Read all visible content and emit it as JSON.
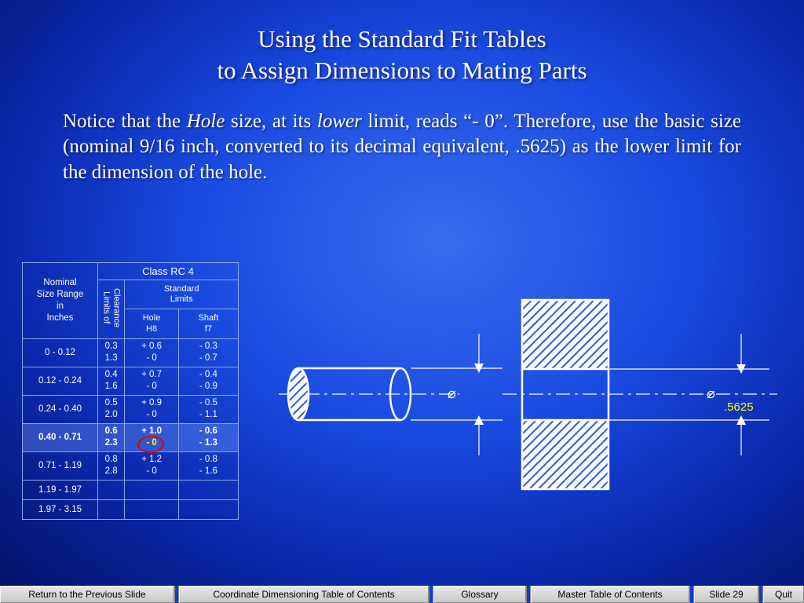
{
  "title": {
    "line1": "Using the Standard Fit Tables",
    "line2": "to Assign Dimensions to Mating Parts"
  },
  "body": {
    "prefix": "Notice that the ",
    "hole_word": "Hole",
    "mid1": " size, at its ",
    "lower_word": "lower",
    "suffix": " limit, reads “- 0”. Therefore, use the basic size (nominal 9/16 inch, converted to its decimal equivalent, .5625) as the lower limit for the dimension of the hole."
  },
  "table": {
    "nominal_label_l1": "Nominal",
    "nominal_label_l2": "Size Range",
    "nominal_label_l3": "in",
    "nominal_label_l4": "Inches",
    "class_label": "Class RC 4",
    "limits_label_l1": "Limits of",
    "limits_label_l2": "Clearance",
    "std_limits_l1": "Standard",
    "std_limits_l2": "Limits",
    "hole_col_l1": "Hole",
    "hole_col_l2": "H8",
    "shaft_col_l1": "Shaft",
    "shaft_col_l2": "f7",
    "rows": [
      {
        "range": "0      - 0.12",
        "clr1": "0.3",
        "clr2": "1.3",
        "hole1": "+ 0.6",
        "hole2": "- 0",
        "shaft1": "- 0.3",
        "shaft2": "- 0.7",
        "hl": false
      },
      {
        "range": "0.12 - 0.24",
        "clr1": "0.4",
        "clr2": "1.6",
        "hole1": "+ 0.7",
        "hole2": "- 0",
        "shaft1": "- 0.4",
        "shaft2": "- 0.9",
        "hl": false
      },
      {
        "range": "0.24 - 0.40",
        "clr1": "0.5",
        "clr2": "2.0",
        "hole1": "+ 0.9",
        "hole2": "- 0",
        "shaft1": "- 0.5",
        "shaft2": "- 1.1",
        "hl": false
      },
      {
        "range": "0.40 - 0.71",
        "clr1": "0.6",
        "clr2": "2.3",
        "hole1": "+ 1.0",
        "hole2": "- 0",
        "shaft1": "- 0.6",
        "shaft2": "- 1.3",
        "hl": true
      },
      {
        "range": "0.71 - 1.19",
        "clr1": "0.8",
        "clr2": "2.8",
        "hole1": "+ 1.2",
        "hole2": "- 0",
        "shaft1": "- 0.8",
        "shaft2": "- 1.6",
        "hl": false
      },
      {
        "range": "1.19 - 1.97",
        "clr1": "",
        "clr2": "",
        "hole1": "",
        "hole2": "",
        "shaft1": "",
        "shaft2": "",
        "hl": false
      },
      {
        "range": "1.97 - 3.15",
        "clr1": "",
        "clr2": "",
        "hole1": "",
        "hole2": "",
        "shaft1": "",
        "shaft2": "",
        "hl": false
      }
    ]
  },
  "diagram": {
    "diameter_symbol": "⌀",
    "value_label": ".5625"
  },
  "footer": {
    "return": "Return to the Previous Slide",
    "coord": "Coordinate Dimensioning Table of Contents",
    "glossary": "Glossary",
    "master": "Master Table of Contents",
    "slide": "Slide 29",
    "quit": "Quit"
  }
}
